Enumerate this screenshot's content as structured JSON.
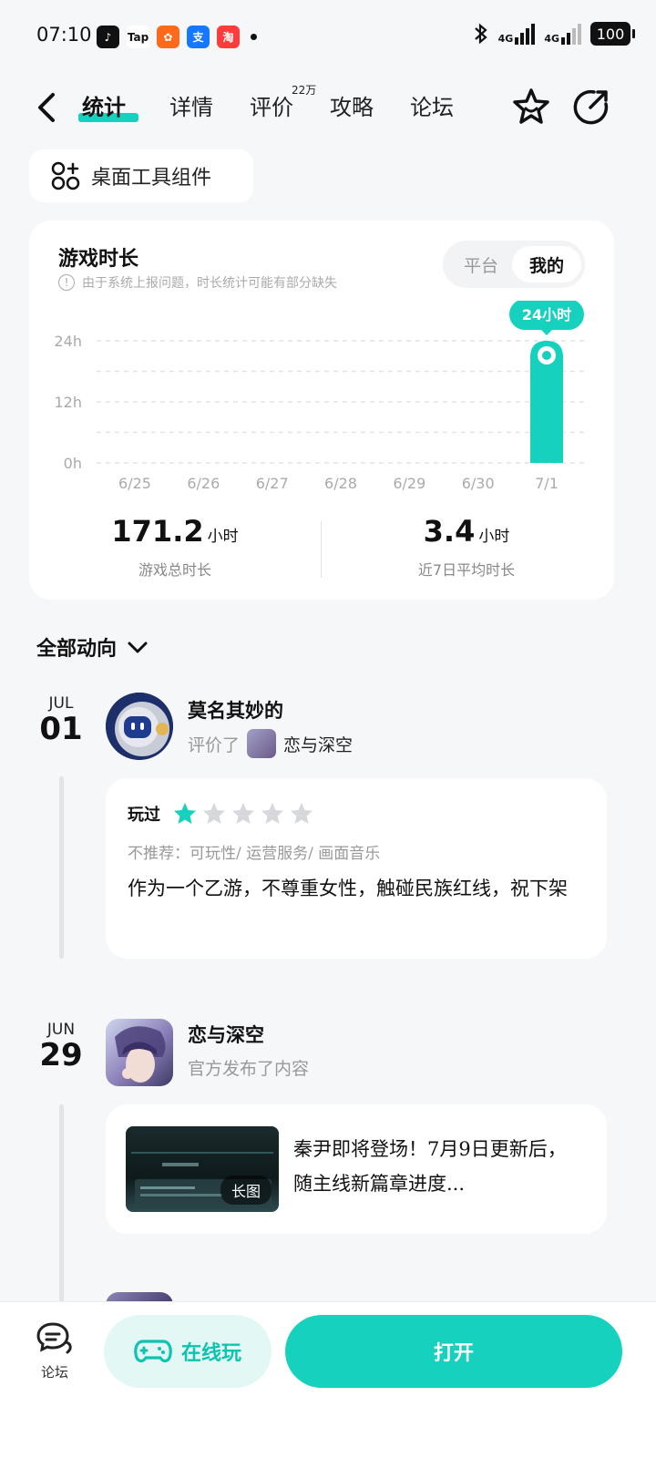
{
  "status_bar": {
    "time": "07:10",
    "app_icons": [
      {
        "name": "tiktok-icon",
        "glyph": "♪",
        "color": "#111111"
      },
      {
        "name": "taptap-icon",
        "glyph": "Tap",
        "color": "#ffffff"
      },
      {
        "name": "kuaishou-icon",
        "glyph": "✿",
        "color": "#ff6a1a"
      },
      {
        "name": "alipay-icon",
        "glyph": "支",
        "color": "#1677ff"
      },
      {
        "name": "taobao-icon",
        "glyph": "淘",
        "color": "#ff3b3b"
      }
    ],
    "signal_1": "4G",
    "signal_2": "4G",
    "battery": "100"
  },
  "nav": {
    "tabs": [
      {
        "label": "统计",
        "active": true
      },
      {
        "label": "详情",
        "active": false
      },
      {
        "label": "评价",
        "active": false
      },
      {
        "label": "攻略",
        "active": false
      },
      {
        "label": "论坛",
        "active": false
      }
    ],
    "review_badge": "22万"
  },
  "widget_button": {
    "label": "桌面工具组件"
  },
  "stats": {
    "title": "游戏时长",
    "note": "由于系统上报问题，时长统计可能有部分缺失",
    "toggle": {
      "options": [
        "平台",
        "我的"
      ],
      "selected": "我的"
    }
  },
  "chart_data": {
    "type": "bar",
    "categories": [
      "6/25",
      "6/26",
      "6/27",
      "6/28",
      "6/29",
      "6/30",
      "7/1"
    ],
    "values": [
      0,
      0,
      0,
      0,
      0,
      0,
      24
    ],
    "ylim": [
      0,
      24
    ],
    "yticks": [
      "0h",
      "12h",
      "24h"
    ],
    "bar_color": "#15d1be",
    "tooltip": "24小时",
    "grid": true
  },
  "totals": {
    "total_value": "171.2",
    "total_unit": "小时",
    "total_label": "游戏总时长",
    "avg_value": "3.4",
    "avg_unit": "小时",
    "avg_label": "近7日平均时长"
  },
  "activity": {
    "header": "全部动向",
    "entries": [
      {
        "month": "JUL",
        "day": "01",
        "user": "莫名其妙的",
        "action": "评价了",
        "target": "恋与深空",
        "played_label": "玩过",
        "rating": 1,
        "rating_max": 5,
        "tags": "不推荐：可玩性/ 运营服务/ 画面音乐",
        "text": "作为一个乙游，不尊重女性，触碰民族红线，祝下架"
      },
      {
        "month": "JUN",
        "day": "29",
        "user": "恋与深空",
        "action": "官方发布了内容",
        "thumb_badge": "长图",
        "text": "秦尹即将登场！7月9日更新后，随主线新篇章进度..."
      }
    ]
  },
  "bottom_bar": {
    "forum_label": "论坛",
    "online_label": "在线玩",
    "open_label": "打开"
  },
  "accent_color": "#15d1be"
}
